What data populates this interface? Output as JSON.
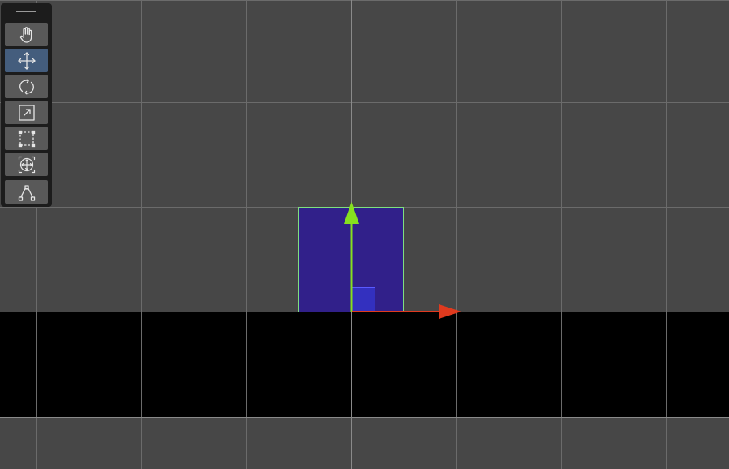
{
  "toolbar": {
    "active_tool": "move-tool",
    "tools": [
      {
        "name": "hand-tool",
        "icon": "hand-icon",
        "active": false
      },
      {
        "name": "move-tool",
        "icon": "move-arrows-icon",
        "active": true
      },
      {
        "name": "rotate-tool",
        "icon": "rotate-icon",
        "active": false
      },
      {
        "name": "scale-tool",
        "icon": "scale-icon",
        "active": false
      },
      {
        "name": "rect-tool",
        "icon": "rect-transform-icon",
        "active": false
      },
      {
        "name": "transform-tool",
        "icon": "transform-all-icon",
        "active": false
      },
      {
        "name": "custom-tool",
        "icon": "path-nodes-icon",
        "active": false
      }
    ]
  },
  "scene": {
    "background_color": "#474747",
    "grid_line_color": "#6b6b6b",
    "axis_line_color": "#8a8a8a",
    "ground_color": "#000000",
    "selected_object": {
      "fill_color": "#31208a",
      "outline_color": "#7fe07f"
    },
    "gizmo": {
      "x_axis_color": "#e03a1e",
      "y_axis_color": "#86e01e",
      "plane_handle_color": "#3f3fe0"
    }
  }
}
